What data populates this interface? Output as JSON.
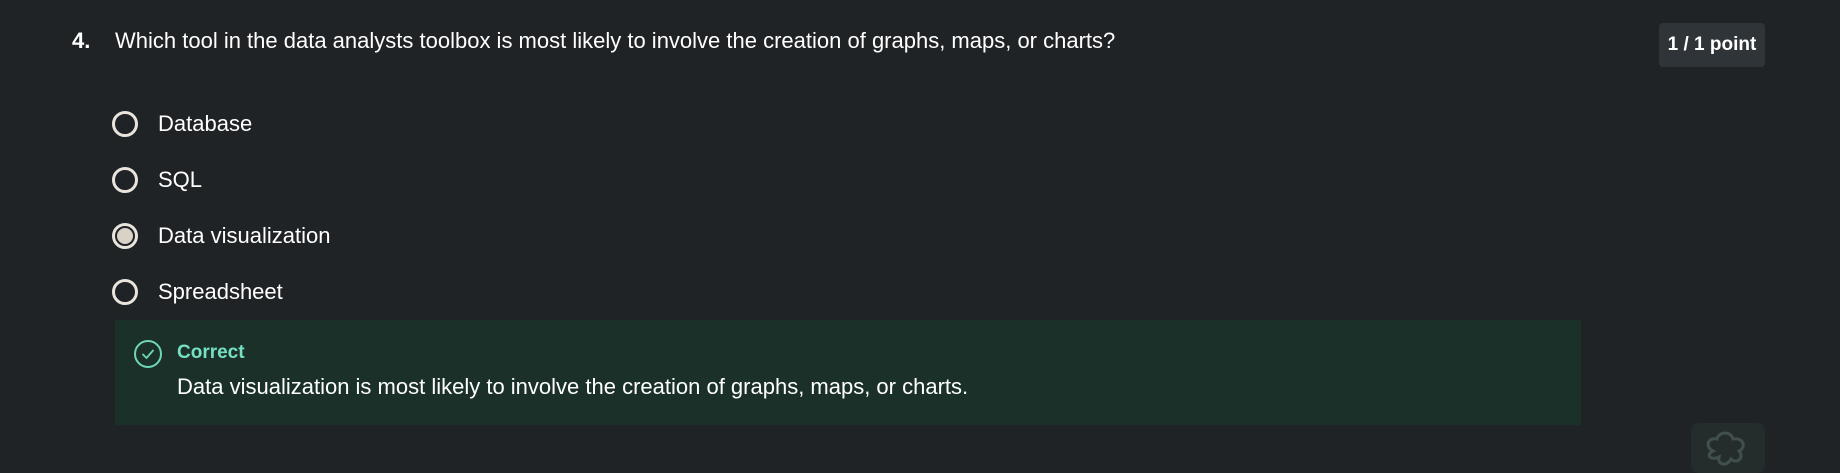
{
  "question": {
    "number": "4.",
    "text": "Which tool in the data analysts toolbox is most likely to involve the creation of graphs, maps, or charts?",
    "score": "1 / 1 point"
  },
  "options": [
    {
      "label": "Database",
      "selected": false
    },
    {
      "label": "SQL",
      "selected": false
    },
    {
      "label": "Data visualization",
      "selected": true
    },
    {
      "label": "Spreadsheet",
      "selected": false
    }
  ],
  "feedback": {
    "status": "Correct",
    "message": "Data visualization is most likely to involve the creation of graphs, maps, or charts."
  },
  "colors": {
    "background": "#1f2325",
    "feedback_background": "#1b3029",
    "correct_accent": "#75e1c2",
    "badge_background": "#2f3438"
  },
  "icons": {
    "feedback": "check-circle-icon",
    "corner": "assistant-icon"
  }
}
